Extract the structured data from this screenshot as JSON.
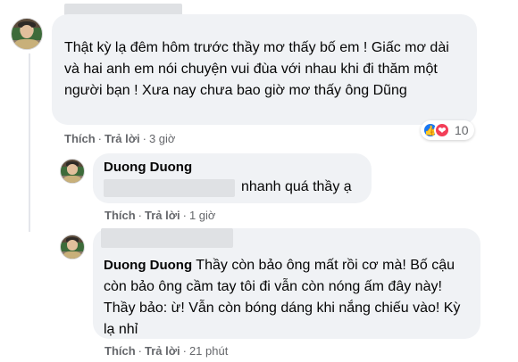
{
  "comments": [
    {
      "author": "",
      "text": "Thật kỳ lạ đêm hôm trước thầy mơ thấy bố em ! Giấc mơ dài và hai anh em nói chuyện vui đùa với nhau khi đi thăm một người bạn ! Xưa nay chưa bao giờ mơ thấy ông Dũng",
      "actions": {
        "like": "Thích",
        "reply": "Trả lời",
        "time": "3 giờ"
      },
      "reactions": {
        "count": "10",
        "icons": [
          "like-icon",
          "love-icon"
        ]
      }
    },
    {
      "author": "Duong Duong",
      "text": "nhanh quá thầy ạ",
      "actions": {
        "like": "Thích",
        "reply": "Trả lời",
        "time": "1 giờ"
      }
    },
    {
      "author": "Duong Duong",
      "text": "Thầy còn bảo ông mất rồi cơ mà! Bố cậu còn bảo ông cầm tay tôi đi vẫn còn nóng ấm đây này! Thầy bảo: ừ! Vẫn còn bóng dáng khi nắng chiếu vào! Kỳ lạ nhỉ",
      "actions": {
        "like": "Thích",
        "reply": "Trả lời",
        "time": "21 phút"
      }
    }
  ],
  "colors": {
    "bubble": "#f0f2f5",
    "meta": "#65676b",
    "like": "#1877f2",
    "love": "#f33e58"
  }
}
